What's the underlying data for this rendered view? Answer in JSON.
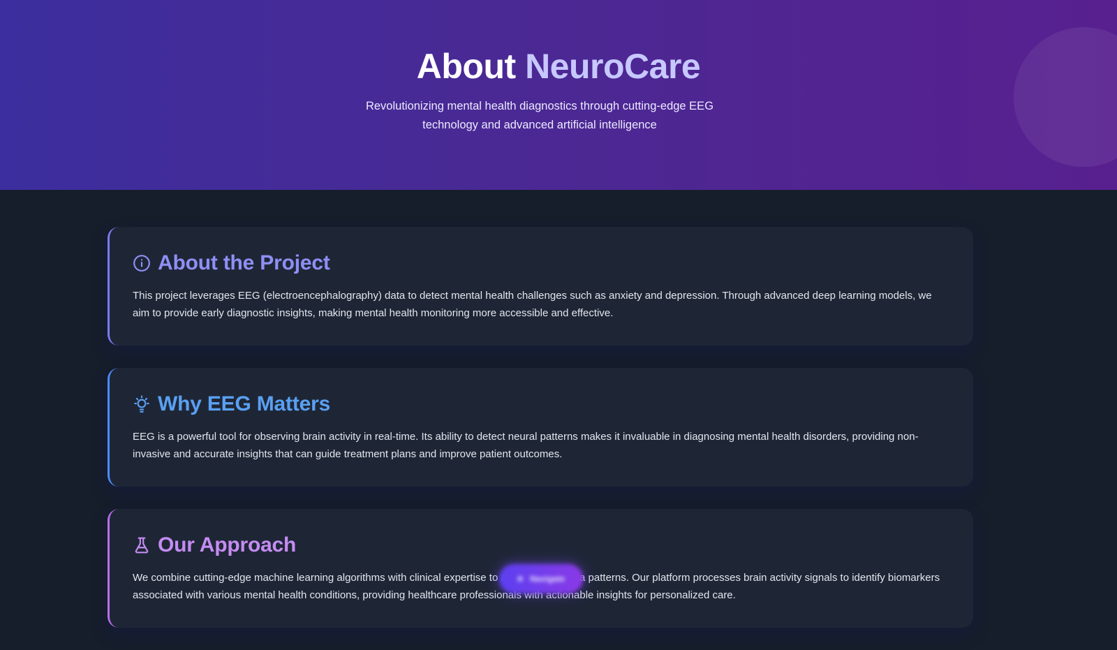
{
  "hero": {
    "title_prefix": "About",
    "title_accent": "NeuroCare",
    "subtitle": "Revolutionizing mental health diagnostics through cutting-edge EEG technology and advanced artificial intelligence"
  },
  "cards": [
    {
      "icon": "info-icon",
      "title": "About the Project",
      "text": "This project leverages EEG (electroencephalography) data to detect mental health challenges such as anxiety and depression. Through advanced deep learning models, we aim to provide early diagnostic insights, making mental health monitoring more accessible and effective."
    },
    {
      "icon": "lightbulb-icon",
      "title": "Why EEG Matters",
      "text": "EEG is a powerful tool for observing brain activity in real-time. Its ability to detect neural patterns makes it invaluable in diagnosing mental health disorders, providing non-invasive and accurate insights that can guide treatment plans and improve patient outcomes."
    },
    {
      "icon": "flask-icon",
      "title": "Our Approach",
      "text": "We combine cutting-edge machine learning algorithms with clinical expertise to analyze EEG data patterns. Our platform processes brain activity signals to identify biomarkers associated with various mental health conditions, providing healthcare professionals with actionable insights for personalized care."
    }
  ],
  "nav_button": {
    "label": "Navigate"
  },
  "colors": {
    "hero_start": "#3c2e9e",
    "hero_end": "#58208f",
    "background": "#161d2b",
    "card": "#1e2636",
    "accent_1": "#8f8ff5",
    "accent_2": "#5aa0f2",
    "accent_3": "#c58cf2"
  }
}
